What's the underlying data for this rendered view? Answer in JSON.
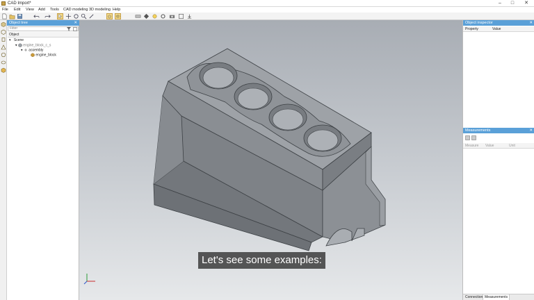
{
  "window": {
    "title": "CAD Import*",
    "minimize": "–",
    "maximize": "□",
    "close": "✕"
  },
  "menu": [
    "File",
    "Edit",
    "View",
    "Add",
    "Tools",
    "CAD modeling",
    "3D modeling",
    "Help"
  ],
  "toolbar": {
    "icons": [
      "new-icon",
      "open-icon",
      "save-icon",
      "undo-icon",
      "redo-icon",
      "select-icon",
      "move-icon",
      "rotate-icon",
      "zoom-icon",
      "sketch-icon",
      "extrude-icon",
      "boolean-icon",
      "measure-icon",
      "render-icon",
      "light-icon",
      "settings-icon"
    ]
  },
  "left_icons": [
    "cube-icon",
    "cube-outline-icon",
    "cylinder-icon",
    "cone-icon",
    "sphere-icon",
    "torus-icon",
    "box-icon"
  ],
  "object_tree": {
    "title": "Object tree",
    "filter_placeholder": "Filter",
    "column": "Object",
    "items": [
      {
        "label": "Scene",
        "level": 0
      },
      {
        "label": "engine_block_c_s",
        "level": 1
      },
      {
        "label": "assembly",
        "level": 2
      },
      {
        "label": "engine_block",
        "level": 3
      }
    ]
  },
  "object_inspector": {
    "title": "Object inspector",
    "columns": [
      "Property",
      "Value"
    ]
  },
  "measurements": {
    "title": "Measurements",
    "columns": [
      "Measure",
      "Value",
      "Unit"
    ],
    "tabs": [
      "Connections",
      "Measurements"
    ],
    "active_tab": "Measurements"
  },
  "caption": "Let's see some examples:",
  "colors": {
    "panel_header": "#5aa0d8",
    "accent": "#f2d98a",
    "model": "#7c8085"
  }
}
